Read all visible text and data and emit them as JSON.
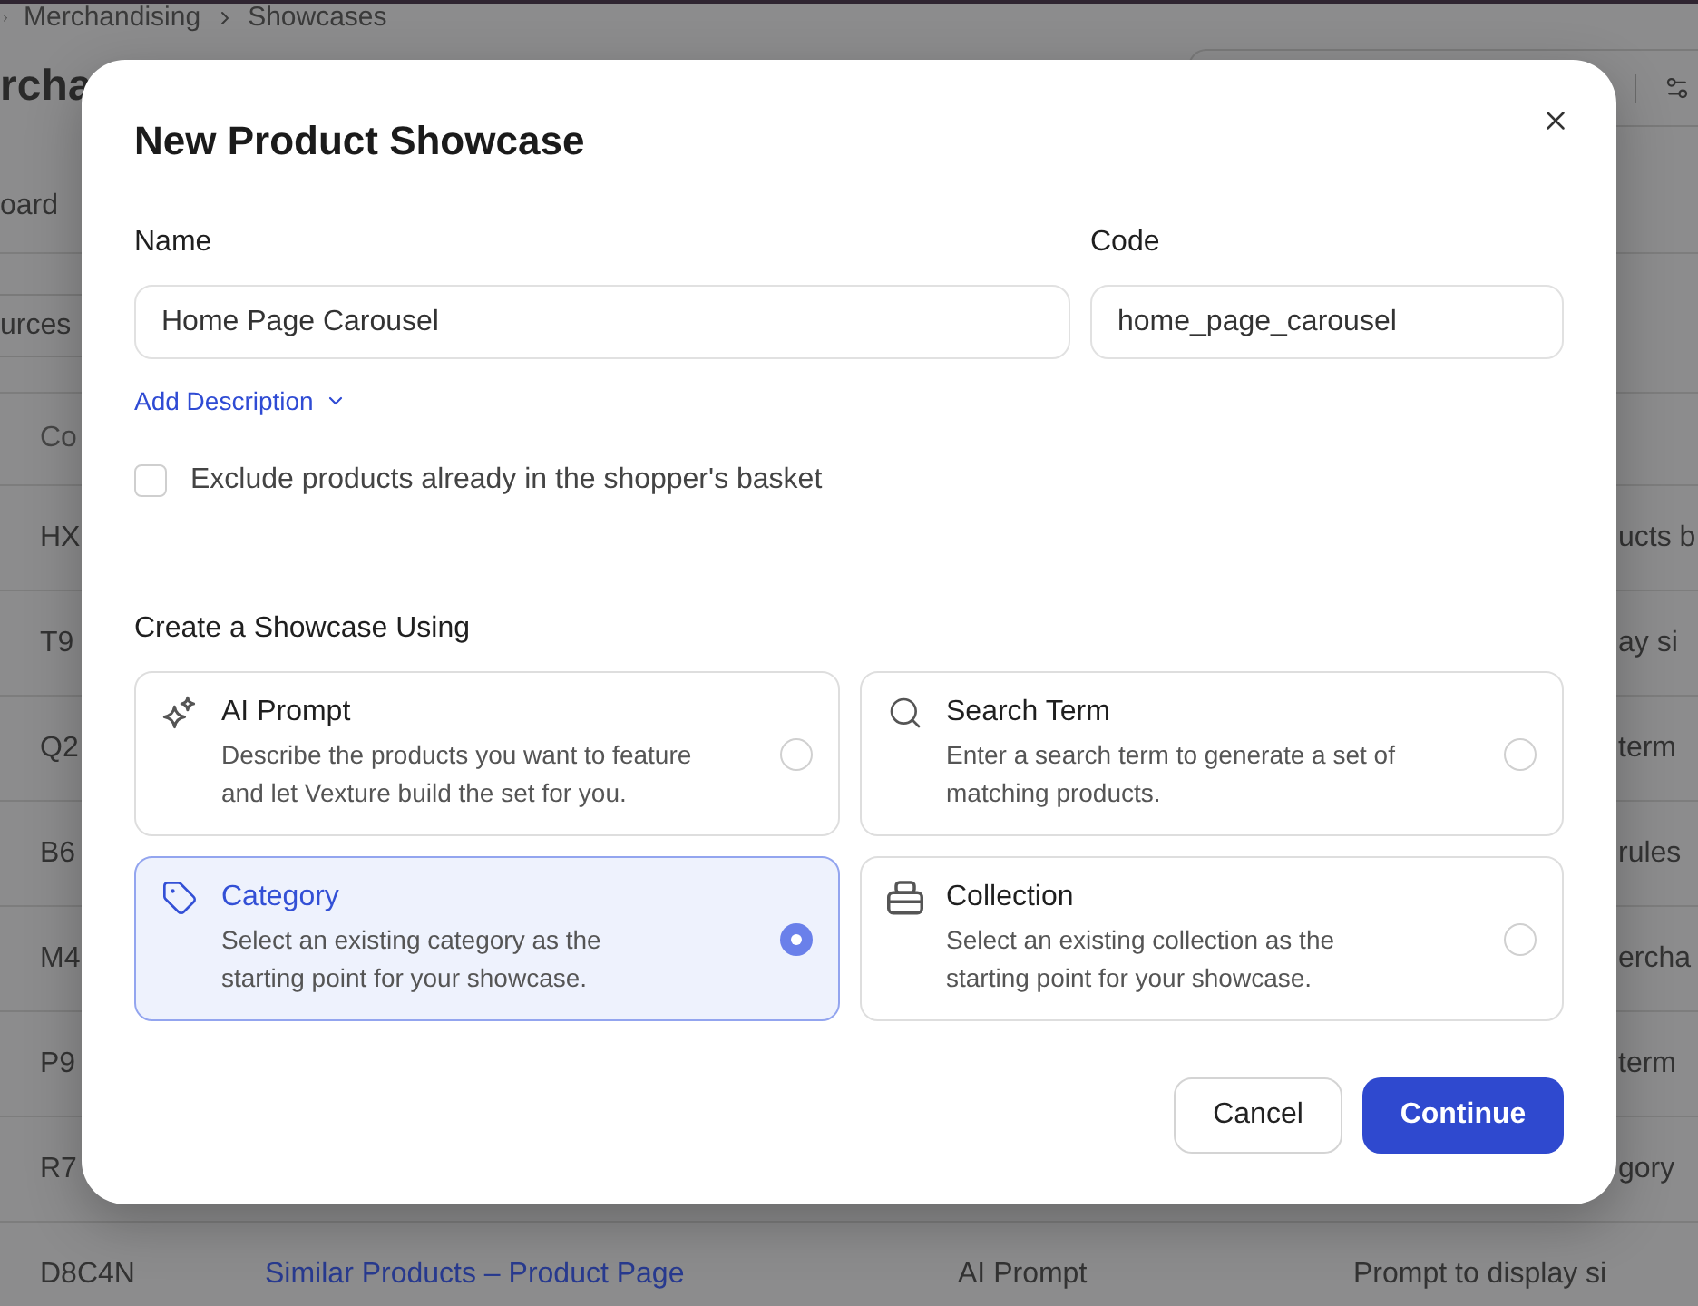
{
  "breadcrumb": [
    "Merchandising",
    "Showcases"
  ],
  "page_title": "rcha",
  "tab": "oard",
  "filter_button": "urces",
  "table": {
    "columns": [
      "Co"
    ],
    "rows": [
      {
        "code": "HX",
        "description": "ucts b"
      },
      {
        "code": "T9",
        "description": "ay si"
      },
      {
        "code": "Q2",
        "description": "term"
      },
      {
        "code": "B6",
        "description": "rules"
      },
      {
        "code": "M4",
        "description": "ercha"
      },
      {
        "code": "P9",
        "description": "term"
      },
      {
        "code": "R7",
        "description": "gory"
      },
      {
        "code": "D8C4N",
        "name": "Similar Products – Product Page",
        "type": "AI Prompt",
        "description": "Prompt to display si"
      }
    ]
  },
  "dialog": {
    "title": "New Product Showcase",
    "name_field": {
      "label": "Name",
      "value": "Home Page Carousel"
    },
    "code_field": {
      "label": "Code",
      "value": "home_page_carousel"
    },
    "add_description": "Add Description",
    "exclude_checkbox": {
      "label": "Exclude products already in the shopper's basket",
      "checked": false
    },
    "section_title": "Create a Showcase Using",
    "options": [
      {
        "title": "AI Prompt",
        "description_lines": [
          "Describe the products you want to feature",
          "and let Vexture build the set for you."
        ],
        "selected": false
      },
      {
        "title": "Search Term",
        "description_lines": [
          "Enter a search term to generate a set of",
          "matching products."
        ],
        "selected": false
      },
      {
        "title": "Category",
        "description_lines": [
          "Select an existing category as the",
          "starting point for your showcase."
        ],
        "selected": true
      },
      {
        "title": "Collection",
        "description_lines": [
          "Select an existing collection as the",
          "starting point for your showcase."
        ],
        "selected": false
      }
    ],
    "buttons": [
      {
        "kind": "secondary",
        "label": "Cancel"
      },
      {
        "kind": "primary",
        "label": "Continue"
      }
    ]
  }
}
